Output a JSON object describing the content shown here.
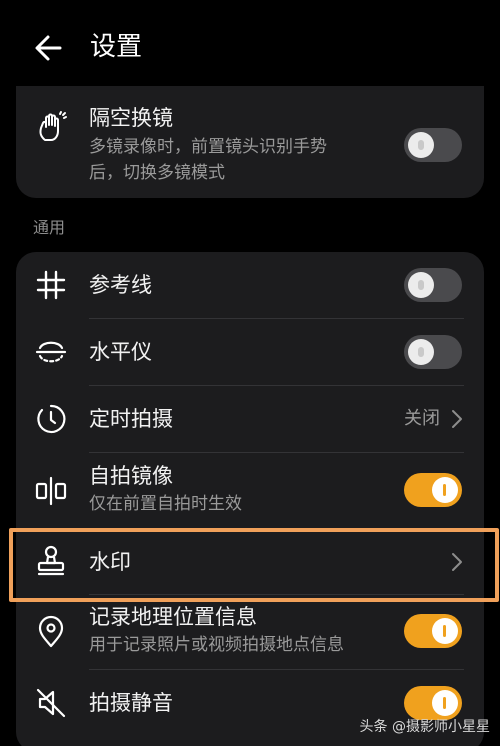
{
  "header": {
    "title": "设置"
  },
  "top_card": {
    "item": {
      "title": "隔空换镜",
      "subtitle_line1": "多镜录像时，前置镜头识别手势",
      "subtitle_line2": "后，切换多镜模式",
      "enabled": false
    }
  },
  "section": {
    "label": "通用"
  },
  "items": [
    {
      "id": "grid",
      "title": "参考线",
      "icon": "grid-hash-icon",
      "control": "toggle",
      "enabled": false
    },
    {
      "id": "level",
      "title": "水平仪",
      "icon": "level-icon",
      "control": "toggle",
      "enabled": false
    },
    {
      "id": "timer",
      "title": "定时拍摄",
      "icon": "timer-icon",
      "control": "value",
      "value": "关闭"
    },
    {
      "id": "mirror",
      "title": "自拍镜像",
      "subtitle": "仅在前置自拍时生效",
      "icon": "mirror-icon",
      "control": "toggle",
      "enabled": true
    },
    {
      "id": "watermark",
      "title": "水印",
      "icon": "stamp-icon",
      "control": "chevron"
    },
    {
      "id": "location",
      "title": "记录地理位置信息",
      "subtitle": "用于记录照片或视频拍摄地点信息",
      "icon": "location-pin-icon",
      "control": "toggle",
      "enabled": true
    },
    {
      "id": "mute",
      "title": "拍摄静音",
      "icon": "mute-icon",
      "control": "toggle",
      "enabled": true
    }
  ],
  "footer": {
    "watermark": "头条 @摄影师小星星"
  },
  "colors": {
    "accent": "#f0a11e",
    "card": "#1c1c1e",
    "highlight": "#f0a05a"
  }
}
